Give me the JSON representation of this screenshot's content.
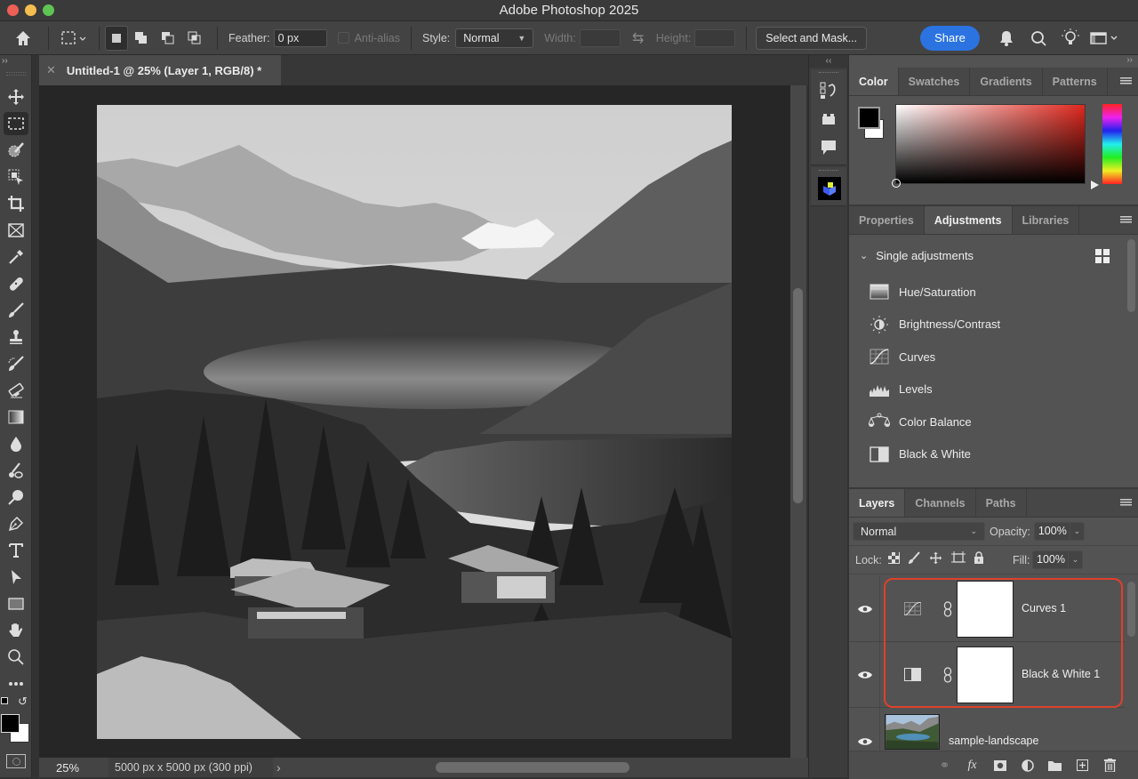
{
  "window": {
    "title": "Adobe Photoshop 2025"
  },
  "options_bar": {
    "feather_label": "Feather:",
    "feather_value": "0 px",
    "antialias_label": "Anti-alias",
    "style_label": "Style:",
    "style_value": "Normal",
    "width_label": "Width:",
    "height_label": "Height:",
    "select_mask_label": "Select and Mask...",
    "share_label": "Share"
  },
  "document": {
    "tab_title": "Untitled-1 @ 25% (Layer 1, RGB/8) *",
    "zoom": "25%",
    "doc_info": "5000 px x 5000 px (300 ppi)"
  },
  "toolbar": {
    "tools": [
      "move-tool",
      "marquee-tool",
      "quick-selection-tool",
      "object-selection-tool",
      "crop-tool",
      "frame-tool",
      "eyedropper-tool",
      "healing-brush-tool",
      "brush-tool",
      "clone-stamp-tool",
      "history-brush-tool",
      "eraser-tool",
      "gradient-tool",
      "blur-tool",
      "smudge-tool",
      "dodge-tool",
      "pen-tool",
      "type-tool",
      "path-selection-tool",
      "rectangle-tool",
      "hand-tool",
      "zoom-tool",
      "more-tools"
    ],
    "foreground_color": "#000000",
    "background_color": "#ffffff"
  },
  "color_panel": {
    "tabs": [
      "Color",
      "Swatches",
      "Gradients",
      "Patterns"
    ],
    "active_tab": "Color",
    "hue_color": "#e0281e"
  },
  "adjustments_panel": {
    "tabs": [
      "Properties",
      "Adjustments",
      "Libraries"
    ],
    "active_tab": "Adjustments",
    "section_title": "Single adjustments",
    "items": [
      {
        "label": "Hue/Saturation",
        "icon": "hue-saturation-icon"
      },
      {
        "label": "Brightness/Contrast",
        "icon": "brightness-contrast-icon"
      },
      {
        "label": "Curves",
        "icon": "curves-icon"
      },
      {
        "label": "Levels",
        "icon": "levels-icon"
      },
      {
        "label": "Color Balance",
        "icon": "color-balance-icon"
      },
      {
        "label": "Black & White",
        "icon": "black-white-icon"
      }
    ]
  },
  "layers_panel": {
    "tabs": [
      "Layers",
      "Channels",
      "Paths"
    ],
    "active_tab": "Layers",
    "blend_mode": "Normal",
    "opacity_label": "Opacity:",
    "opacity_value": "100%",
    "lock_label": "Lock:",
    "fill_label": "Fill:",
    "fill_value": "100%",
    "layers": [
      {
        "name": "Curves 1",
        "type": "curves-adjustment",
        "visible": true
      },
      {
        "name": "Black & White 1",
        "type": "black-white-adjustment",
        "visible": true
      },
      {
        "name": "sample-landscape",
        "type": "image",
        "visible": true
      }
    ],
    "highlight_color": "#e0402c"
  }
}
